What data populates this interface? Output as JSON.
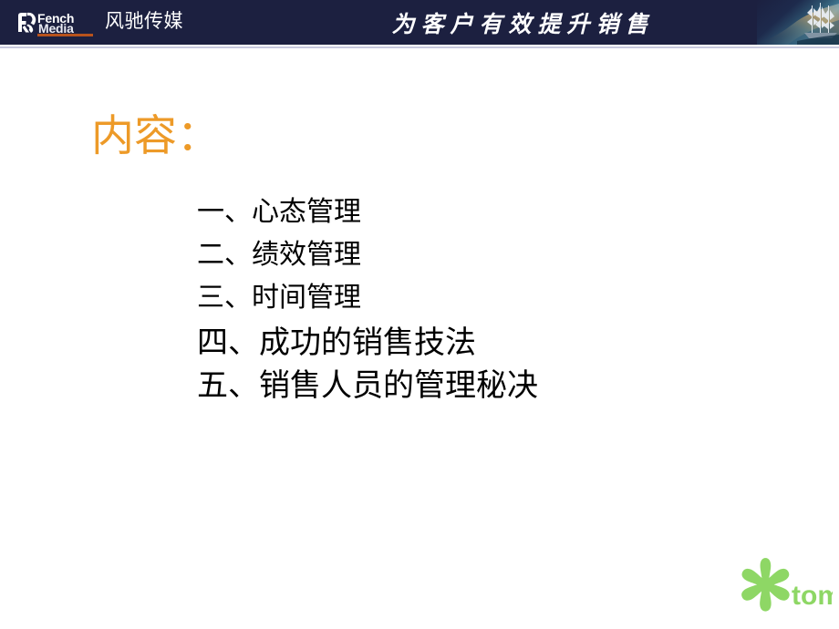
{
  "slide": {
    "background_color": "#ffffff",
    "title": "内容："
  },
  "header": {
    "background_color": "#1c2040",
    "separator_color": "#c9cade",
    "brand": {
      "logo_line1": "Fench",
      "logo_line2": "Media",
      "rule_color": "#b7521c",
      "company_cn": "风驰传媒"
    },
    "slogan": "为客户有效提升销售",
    "artwork": "sailing-ship-image"
  },
  "contents": {
    "title": "内容：",
    "title_color": "#ed9a28",
    "items": [
      {
        "num": "一、",
        "text": "心态管理",
        "size": "small"
      },
      {
        "num": "二、",
        "text": "绩效管理",
        "size": "small"
      },
      {
        "num": "三、",
        "text": "时间管理",
        "size": "small"
      },
      {
        "num": "四、",
        "text": "成功的销售技法",
        "size": "large"
      },
      {
        "num": "五、",
        "text": "销售人员的管理秘决",
        "size": "large"
      }
    ]
  },
  "footer": {
    "tom_logo": {
      "wordmark": "tom",
      "color": "#8ed765",
      "icon": "asterisk-flower-icon"
    }
  }
}
